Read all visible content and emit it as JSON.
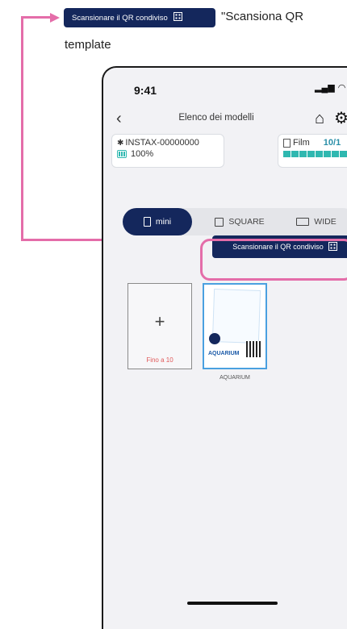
{
  "annotation": {
    "button_label": "Scansionare il QR condiviso",
    "quote_text": "\"Scansiona QR",
    "template_text": "template"
  },
  "status_bar": {
    "time": "9:41"
  },
  "nav": {
    "title": "Elenco dei modelli"
  },
  "device": {
    "name": "INSTAX-00000000",
    "battery": "100%"
  },
  "film": {
    "label": "Film",
    "count": "10/1"
  },
  "tabs": [
    {
      "label": "mini",
      "active": true
    },
    {
      "label": "SQUARE",
      "active": false
    },
    {
      "label": "WIDE",
      "active": false
    }
  ],
  "scan_button": {
    "label": "Scansionare il QR condiviso"
  },
  "add_tile": {
    "plus": "+",
    "limit": "Fino a 10"
  },
  "template_tile": {
    "thumb_label": "AQUARIUM",
    "name": "AQUARIUM"
  },
  "colors": {
    "accent": "#14275c",
    "callout": "#e46da9",
    "film_bar": "#2fb8b0",
    "limit_text": "#e05a5a"
  },
  "icons": [
    "bluetooth-icon",
    "battery-icon",
    "film-icon",
    "home-icon",
    "gear-icon",
    "qr-code-icon",
    "back-chevron-icon"
  ]
}
